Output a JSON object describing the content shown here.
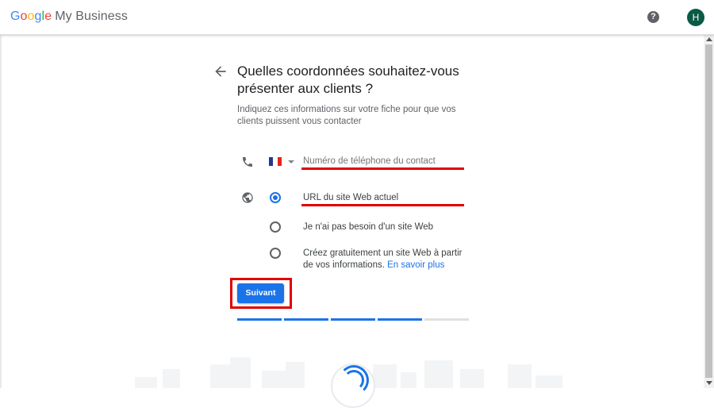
{
  "header": {
    "logo_google": [
      "G",
      "o",
      "o",
      "g",
      "l",
      "e"
    ],
    "logo_product": "My Business",
    "help_icon": "?",
    "avatar_initial": "H"
  },
  "main": {
    "title": "Quelles coordonnées souhaitez-vous présenter aux clients ?",
    "subtitle": "Indiquez ces informations sur votre fiche pour que vos clients puissent vous contacter",
    "phone": {
      "country": "FR",
      "placeholder": "Numéro de téléphone du contact"
    },
    "website": {
      "options": [
        {
          "label": "URL du site Web actuel",
          "selected": true
        },
        {
          "label": "Je n'ai pas besoin d'un site Web",
          "selected": false
        },
        {
          "label": "Créez gratuitement un site Web à partir de vos informations.",
          "link": "En savoir plus",
          "selected": false
        }
      ]
    },
    "next_label": "Suivant",
    "progress": {
      "completed": 4,
      "total": 5
    }
  },
  "colors": {
    "accent": "#1a73e8",
    "annotation": "#e00000",
    "avatar": "#0b5a46"
  }
}
